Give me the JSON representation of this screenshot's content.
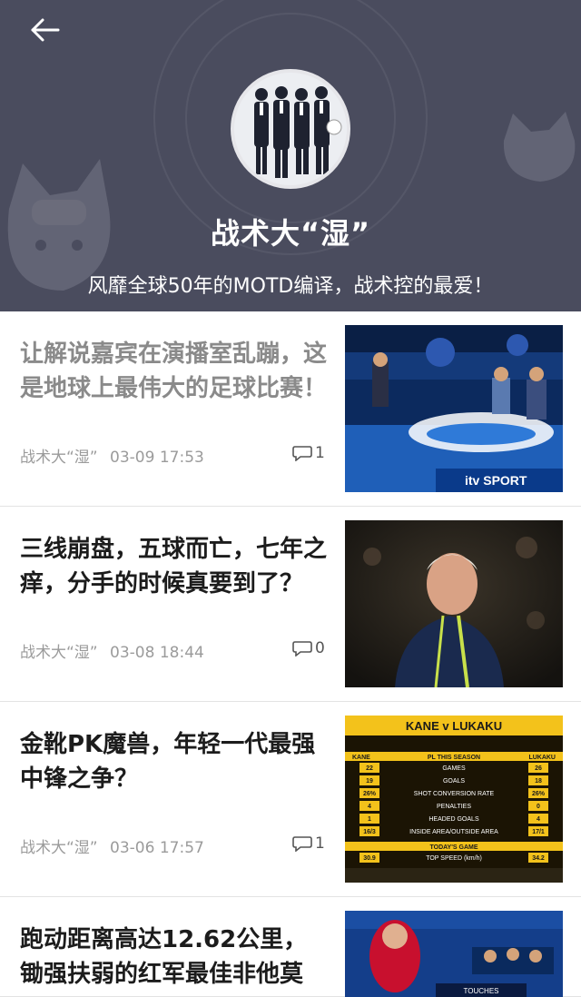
{
  "header": {
    "title": "战术大“湿”",
    "subtitle": "风靡全球50年的MOTD编译，战术控的最爱！",
    "colors": {
      "background": "#4a4c5e",
      "text": "#ffffff"
    }
  },
  "articles": [
    {
      "title": "让解说嘉宾在演播室乱蹦，这是地球上最伟大的足球比赛！",
      "author": "战术大“湿”",
      "date": "03-09 17:53",
      "comments": "1",
      "read": true
    },
    {
      "title": "三线崩盘，五球而亡，七年之痒，分手的时候真要到了？",
      "author": "战术大“湿”",
      "date": "03-08 18:44",
      "comments": "0",
      "read": false
    },
    {
      "title": "金靴PK魔兽，年轻一代最强中锋之争？",
      "author": "战术大“湿”",
      "date": "03-06 17:57",
      "comments": "1",
      "read": false
    },
    {
      "title": "跑动距离高达12.62公里，锄强扶弱的红军最佳非他莫",
      "author": "",
      "date": "",
      "comments": "",
      "read": false
    }
  ],
  "thumb1": {
    "brand": "itv SPORT"
  },
  "thumb3": {
    "title": "KANE v LUKAKU",
    "left_name": "KANE",
    "right_name": "LUKAKU",
    "section1": "PL THIS SEASON",
    "rows": [
      {
        "left": "22",
        "label": "GAMES",
        "right": "26"
      },
      {
        "left": "19",
        "label": "GOALS",
        "right": "18"
      },
      {
        "left": "26%",
        "label": "SHOT CONVERSION RATE",
        "right": "26%"
      },
      {
        "left": "4",
        "label": "PENALTIES",
        "right": "0"
      },
      {
        "left": "1",
        "label": "HEADED GOALS",
        "right": "4"
      },
      {
        "left": "16/3",
        "label": "INSIDE AREA/OUTSIDE AREA",
        "right": "17/1"
      }
    ],
    "section2": "TODAY'S GAME",
    "speed": {
      "left": "30.9",
      "label": "TOP SPEED (km/h)",
      "right": "34.2"
    }
  },
  "thumb4": {
    "label": "TOUCHES"
  }
}
